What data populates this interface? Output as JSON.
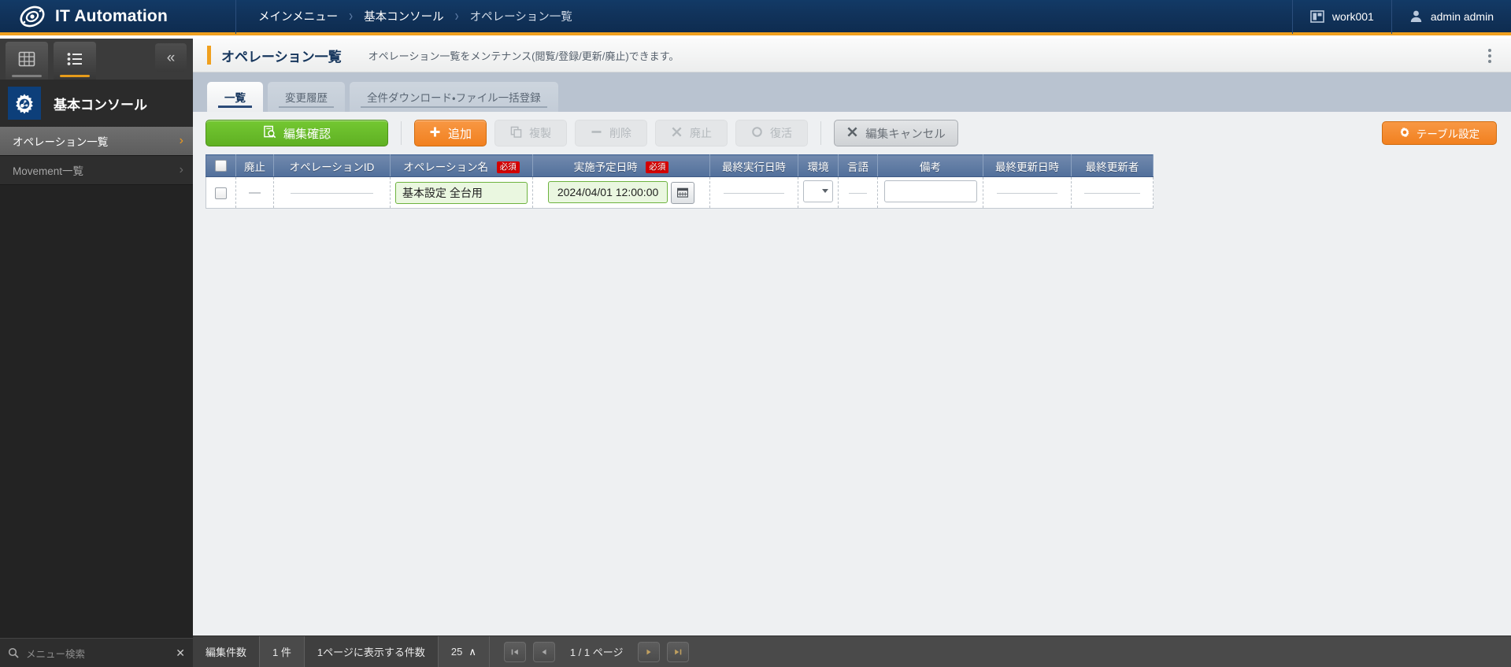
{
  "app": {
    "brand": "IT Automation",
    "logo_icon": "swirl-logo-icon"
  },
  "breadcrumb": {
    "items": [
      "メインメニュー",
      "基本コンソール",
      "オペレーション一覧"
    ],
    "separator": "›"
  },
  "topright": {
    "workspace": "work001",
    "workspace_icon": "window-panel-icon",
    "user": "admin admin",
    "user_icon": "person-icon"
  },
  "sidebar": {
    "tabs": [
      {
        "name": "grid-view-tab",
        "icon": "grid-icon",
        "active": false
      },
      {
        "name": "list-view-tab",
        "icon": "list-icon",
        "active": true
      }
    ],
    "collapse_icon": "«",
    "section_title": "基本コンソール",
    "section_icon": "gear-network-icon",
    "items": [
      {
        "label": "オペレーション一覧",
        "active": true,
        "chevron": "›"
      },
      {
        "label": "Movement一覧",
        "active": false,
        "chevron": "›"
      }
    ],
    "search_placeholder": "メニュー検索",
    "search_icon": "search-icon",
    "search_clear_icon": "close-x-icon"
  },
  "page": {
    "title": "オペレーション一覧",
    "subtitle": "オペレーション一覧をメンテナンス(閲覧/登録/更新/廃止)できます。",
    "menu_icon": "kebab-menu-icon"
  },
  "tabs": [
    {
      "label": "一覧",
      "active": true
    },
    {
      "label": "変更履歴",
      "active": false
    },
    {
      "label": "全件ダウンロード・ファイル一括登録",
      "active": false
    }
  ],
  "toolbar": {
    "confirm_edit": {
      "label": "編集確認",
      "icon": "document-search-icon",
      "enabled": true
    },
    "add": {
      "label": "追加",
      "icon": "plus-icon",
      "enabled": true
    },
    "duplicate": {
      "label": "複製",
      "icon": "copy-icon",
      "enabled": false
    },
    "delete": {
      "label": "削除",
      "icon": "minus-icon",
      "enabled": false
    },
    "discontinue": {
      "label": "廃止",
      "icon": "x-icon",
      "enabled": false
    },
    "restore": {
      "label": "復活",
      "icon": "circle-icon",
      "enabled": false
    },
    "cancel_edit": {
      "label": "編集キャンセル",
      "icon": "x-icon",
      "enabled": true
    },
    "table_settings": {
      "label": "テーブル設定",
      "icon": "gear-icon",
      "enabled": true
    }
  },
  "table": {
    "required_badge": "必須",
    "columns": [
      {
        "key": "check",
        "label": "",
        "icon": "checkbox-icon",
        "required": false
      },
      {
        "key": "abolish",
        "label": "廃止",
        "required": false
      },
      {
        "key": "operation_id",
        "label": "オペレーションID",
        "required": false
      },
      {
        "key": "operation_name",
        "label": "オペレーション名",
        "required": true
      },
      {
        "key": "scheduled_datetime",
        "label": "実施予定日時",
        "required": true
      },
      {
        "key": "last_exec_datetime",
        "label": "最終実行日時",
        "required": false
      },
      {
        "key": "environment",
        "label": "環境",
        "required": false
      },
      {
        "key": "language",
        "label": "言語",
        "required": false
      },
      {
        "key": "remarks",
        "label": "備考",
        "required": false
      },
      {
        "key": "last_update_datetime",
        "label": "最終更新日時",
        "required": false
      },
      {
        "key": "last_updater",
        "label": "最終更新者",
        "required": false
      }
    ],
    "rows": [
      {
        "check": "",
        "abolish": "—",
        "operation_id": "",
        "operation_name": "基本設定 全台用",
        "scheduled_datetime": "2024/04/01 12:00:00",
        "calendar_icon": "calendar-icon",
        "last_exec_datetime": "",
        "environment": "",
        "language": "—",
        "remarks": "",
        "last_update_datetime": "",
        "last_updater": ""
      }
    ]
  },
  "footer": {
    "edit_count_label": "編集件数",
    "edit_count_value": "1 件",
    "per_page_label": "1ページに表示する件数",
    "per_page_value": "25",
    "per_page_caret": "∧",
    "first_icon": "first-page-icon",
    "prev_icon": "prev-page-icon",
    "page_text": "1 / 1 ページ",
    "next_icon": "next-page-icon",
    "last_icon": "last-page-icon"
  },
  "colors": {
    "header_blue": "#11335b",
    "accent_orange": "#f0a01e",
    "green_button": "#5fb023",
    "orange_button": "#f1801f",
    "table_header": "#516f9b",
    "required_red": "#d50000"
  }
}
